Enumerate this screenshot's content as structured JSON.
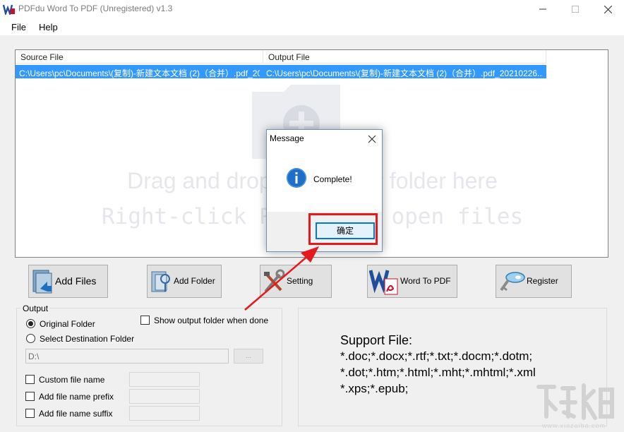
{
  "window": {
    "title": "PDFdu Word To PDF (Unregistered) v1.3"
  },
  "menu": {
    "items": [
      {
        "label": "File"
      },
      {
        "label": "Help"
      }
    ]
  },
  "file_list": {
    "columns": [
      "Source File",
      "Output File"
    ],
    "rows": [
      {
        "source": "C:\\Users\\pc\\Documents\\(复制)-新建文本文档 (2)（合并）.pdf_2021022609...",
        "output": "C:\\Users\\pc\\Documents\\(复制)-新建文本文档 (2)（合并）.pdf_20210226..."
      }
    ],
    "placeholder_line1": "Drag and drop your file or folder here",
    "placeholder_line2": "Right-click Remove or open files"
  },
  "toolbar": {
    "add_files": "Add Files",
    "add_folder": "Add Folder",
    "setting": "Setting",
    "word_to_pdf": "Word To PDF",
    "register": "Register"
  },
  "output": {
    "legend": "Output",
    "original_folder": "Original Folder",
    "select_destination": "Select Destination Folder",
    "show_output_folder": "Show output folder when done",
    "path_value": "D:\\",
    "browse_label": "...",
    "custom_file_name": "Custom file name",
    "add_prefix": "Add file name prefix",
    "add_suffix": "Add file name suffix",
    "selected_option": "Original Folder"
  },
  "support": {
    "title": "Support File:",
    "lines": [
      "*.doc;*.docx;*.rtf;*.txt;*.docm;*.dotm;",
      "*.dot;*.htm;*.html;*.mht;*.mhtml;*.xml",
      "*.xps;*.epub;"
    ]
  },
  "dialog": {
    "title": "Message",
    "message": "Complete!",
    "ok_label": "确定"
  },
  "watermark": {
    "caption": "www.xiazaiba.com"
  },
  "colors": {
    "selection": "#3399ff",
    "highlight_box": "#e5191b",
    "dialog_button_border": "#0078d7"
  }
}
